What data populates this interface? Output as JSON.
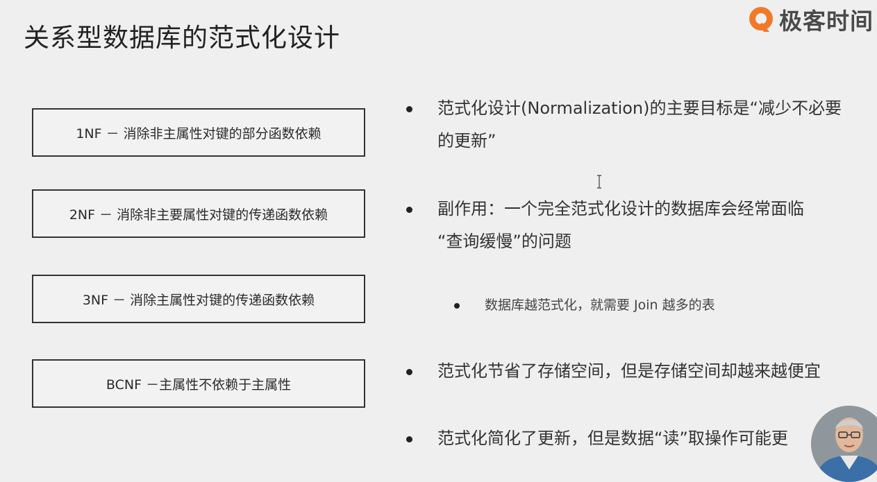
{
  "slide": {
    "title": "关系型数据库的范式化设计"
  },
  "logo": {
    "text": "极客时间"
  },
  "normal_forms": [
    {
      "label": "1NF － 消除非主属性对键的部分函数依赖"
    },
    {
      "label": "2NF － 消除非主要属性对键的传递函数依赖"
    },
    {
      "label": "3NF － 消除主属性对键的传递函数依赖"
    },
    {
      "label": "BCNF －主属性不依赖于主属性"
    }
  ],
  "bullets": {
    "normalization_goal": "范式化设计(Normalization)的主要目标是“减少不必要\n的更新”",
    "side_effect": "副作用：一个完全范式化设计的数据库会经常面临\n“查询缓慢”的问题",
    "join_note": "数据库越范式化，就需要 Join 越多的表",
    "storage": "范式化节省了存储空间，但是存储空间却越来越便宜",
    "simplify": "范式化简化了更新，但是数据“读”取操作可能更"
  },
  "colors": {
    "background": "#efefef",
    "logo_orange": "#f07a2a",
    "text": "#2b2b2b"
  }
}
